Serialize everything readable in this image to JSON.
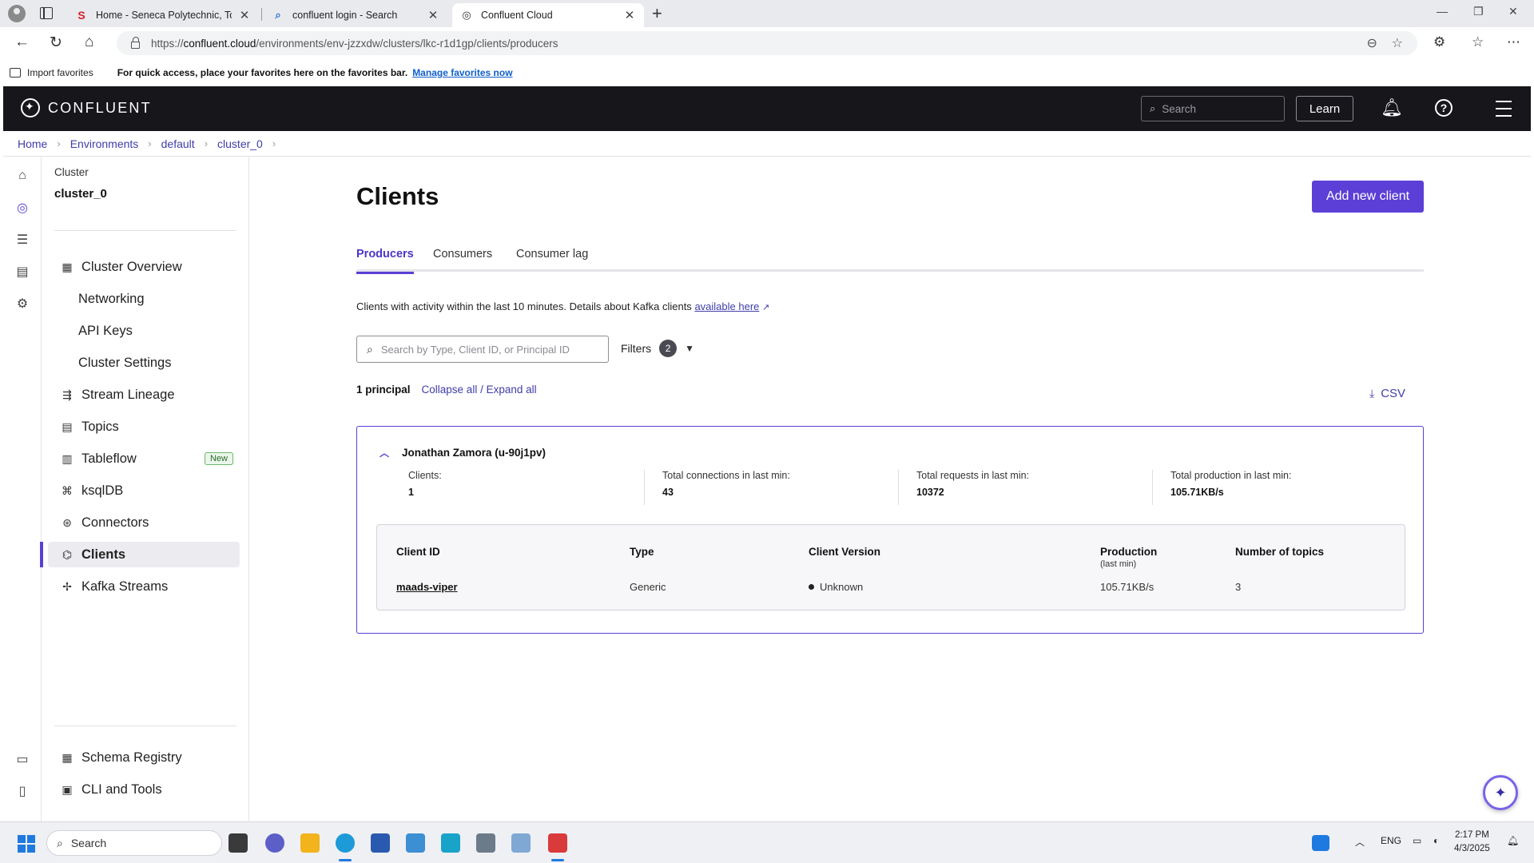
{
  "browser": {
    "tabs": [
      {
        "title": "Home - Seneca Polytechnic, Toronto",
        "icon": "seneca-s-icon"
      },
      {
        "title": "confluent login - Search",
        "icon": "search-icon"
      },
      {
        "title": "Confluent Cloud",
        "icon": "confluent-icon"
      }
    ],
    "url_prefix": "https://",
    "url_host": "confluent.cloud",
    "url_path": "/environments/env-jzzxdw/clusters/lkc-r1d1gp/clients/producers",
    "favorites": {
      "import": "Import favorites",
      "hint": "For quick access, place your favorites here on the favorites bar.",
      "manage": "Manage favorites now"
    }
  },
  "header": {
    "logo": "CONFLUENT",
    "search_placeholder": "Search",
    "learn": "Learn"
  },
  "breadcrumb": [
    "Home",
    "Environments",
    "default",
    "cluster_0"
  ],
  "sidebar": {
    "caption": "Cluster",
    "cluster_name": "cluster_0",
    "items": [
      {
        "label": "Cluster Overview"
      },
      {
        "label": "Networking"
      },
      {
        "label": "API Keys"
      },
      {
        "label": "Cluster Settings"
      },
      {
        "label": "Stream Lineage"
      },
      {
        "label": "Topics"
      },
      {
        "label": "Tableflow",
        "badge": "New"
      },
      {
        "label": "ksqlDB"
      },
      {
        "label": "Connectors"
      },
      {
        "label": "Clients"
      },
      {
        "label": "Kafka Streams"
      },
      {
        "label": "Schema Registry"
      },
      {
        "label": "CLI and Tools"
      }
    ]
  },
  "main": {
    "title": "Clients",
    "add_button": "Add new client",
    "tabs": [
      "Producers",
      "Consumers",
      "Consumer lag"
    ],
    "description": "Clients with activity within the last 10 minutes. Details about Kafka clients",
    "description_link": "available here",
    "search_placeholder": "Search by Type, Client ID, or Principal ID",
    "filters_label": "Filters",
    "filters_count": "2",
    "principal_count": "1 principal",
    "collapse_all": "Collapse all",
    "expand_all": "Expand all",
    "csv": "CSV",
    "principal": {
      "name": "Jonathan Zamora (u-90j1pv)",
      "stats": [
        {
          "label": "Clients:",
          "value": "1"
        },
        {
          "label": "Total connections in last min:",
          "value": "43"
        },
        {
          "label": "Total requests in last min:",
          "value": "10372"
        },
        {
          "label": "Total production in last min:",
          "value": "105.71KB/s"
        }
      ],
      "table": {
        "headers": [
          "Client ID",
          "Type",
          "Client Version",
          "Production",
          "Number of topics"
        ],
        "production_sub": "(last min)",
        "rows": [
          {
            "client_id": "maads-viper",
            "type": "Generic",
            "version": "Unknown",
            "production": "105.71KB/s",
            "topics": "3"
          }
        ]
      }
    }
  },
  "taskbar": {
    "search": "Search",
    "lang": "ENG",
    "time": "2:17 PM",
    "date": "4/3/2025"
  }
}
